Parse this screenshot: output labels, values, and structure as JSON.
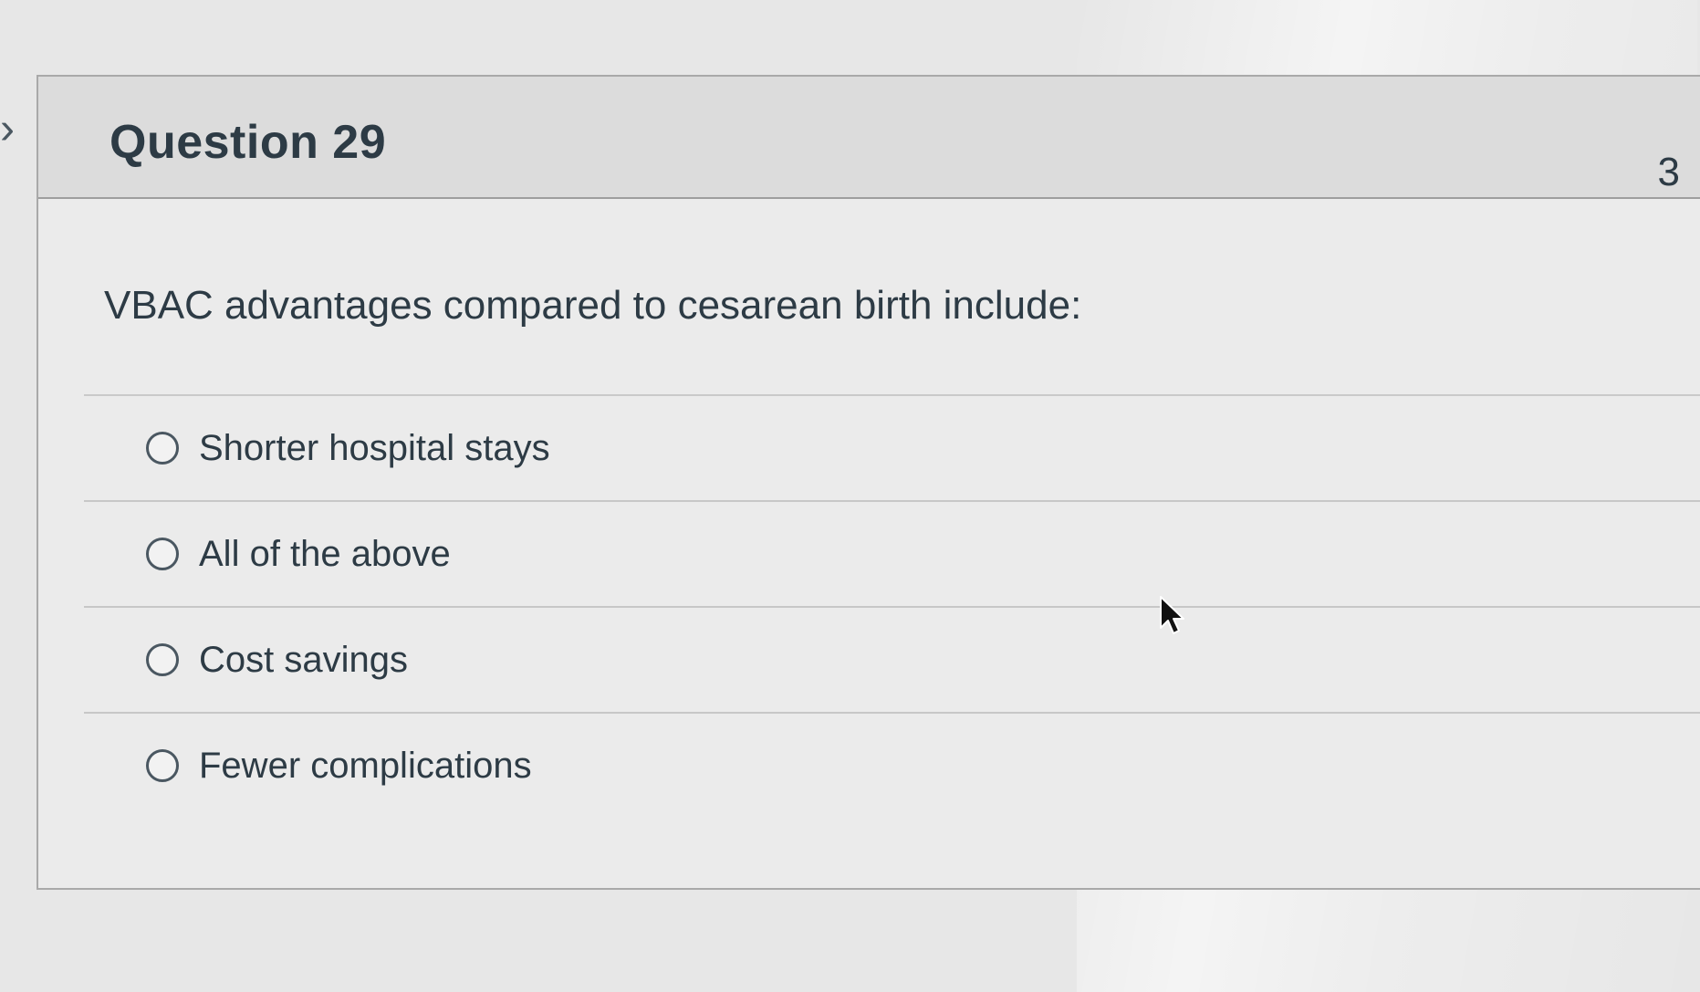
{
  "question": {
    "title": "Question 29",
    "points": "3",
    "text": "VBAC advantages compared to cesarean birth include:",
    "answers": [
      {
        "label": "Shorter hospital stays",
        "selected": false
      },
      {
        "label": "All of the above",
        "selected": false
      },
      {
        "label": "Cost savings",
        "selected": false
      },
      {
        "label": "Fewer complications",
        "selected": false
      }
    ]
  },
  "icons": {
    "collapse": "chevron-right-icon",
    "radio": "radio-button-icon",
    "cursor": "mouse-pointer-icon"
  },
  "colors": {
    "text": "#2d3b45",
    "header_bg": "#dcdcdc",
    "card_border": "#a9a9a9"
  }
}
